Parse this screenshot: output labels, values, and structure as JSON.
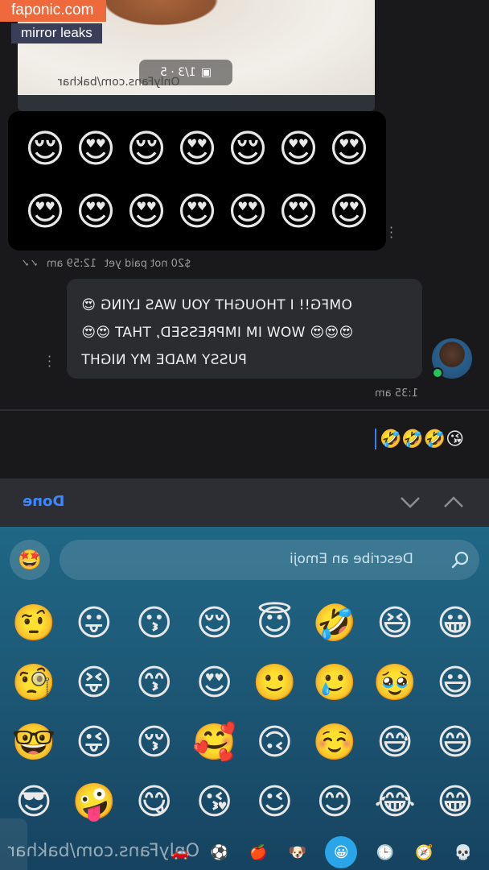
{
  "watermark": {
    "site": "faponic.com",
    "tag": "mirror leaks"
  },
  "media_preview": {
    "counter": "1/3 · 5",
    "watermark": "OnlyFans.com/bakhar"
  },
  "message_emojis": {
    "row1": [
      "😌",
      "😍",
      "😌",
      "😍",
      "😌",
      "😍",
      "😍"
    ],
    "row2": [
      "😍",
      "😍",
      "😍",
      "😍",
      "😍",
      "😍",
      "😍"
    ]
  },
  "message_meta": {
    "price": "$20 not paid yet",
    "time": "12:59 am"
  },
  "incoming_message": {
    "line1": "OMFG!! I THOUGHT YOU WAS LYING 😍",
    "line2": "😍😍😍 WOW IM IMPRESSED, THAT 😍😍",
    "line3": "PUSSY MADE MY NIGHT",
    "time": "1:35 am"
  },
  "composer": {
    "text": "🤣🤣🤣😘"
  },
  "toolbar": {
    "done_label": "Done"
  },
  "keyboard": {
    "search_placeholder": "Describe an Emoji",
    "grid": [
      [
        "🤨",
        "😛",
        "😗",
        "😌",
        "😇",
        "🤣",
        "😆",
        "😀"
      ],
      [
        "🧐",
        "😝",
        "😙",
        "😍",
        "🙂",
        "🥲",
        "🥹",
        "😃"
      ],
      [
        "🤓",
        "😜",
        "😚",
        "🥰",
        "🙃",
        "☺️",
        "😅",
        "😄"
      ],
      [
        "😎",
        "🤪",
        "😋",
        "😘",
        "😉",
        "😊",
        "😂",
        "😁"
      ]
    ],
    "categories": [
      "💀",
      "🧭",
      "🕒",
      "😀",
      "🐶",
      "🍎",
      "⚽",
      "🚗"
    ],
    "active_category": "😀",
    "bottom_watermark": "OnlyFans.com/bakhar"
  },
  "colors": {
    "accent": "#3b88ff",
    "online": "#24c45a",
    "watermark_orange": "#ee6a3c"
  }
}
